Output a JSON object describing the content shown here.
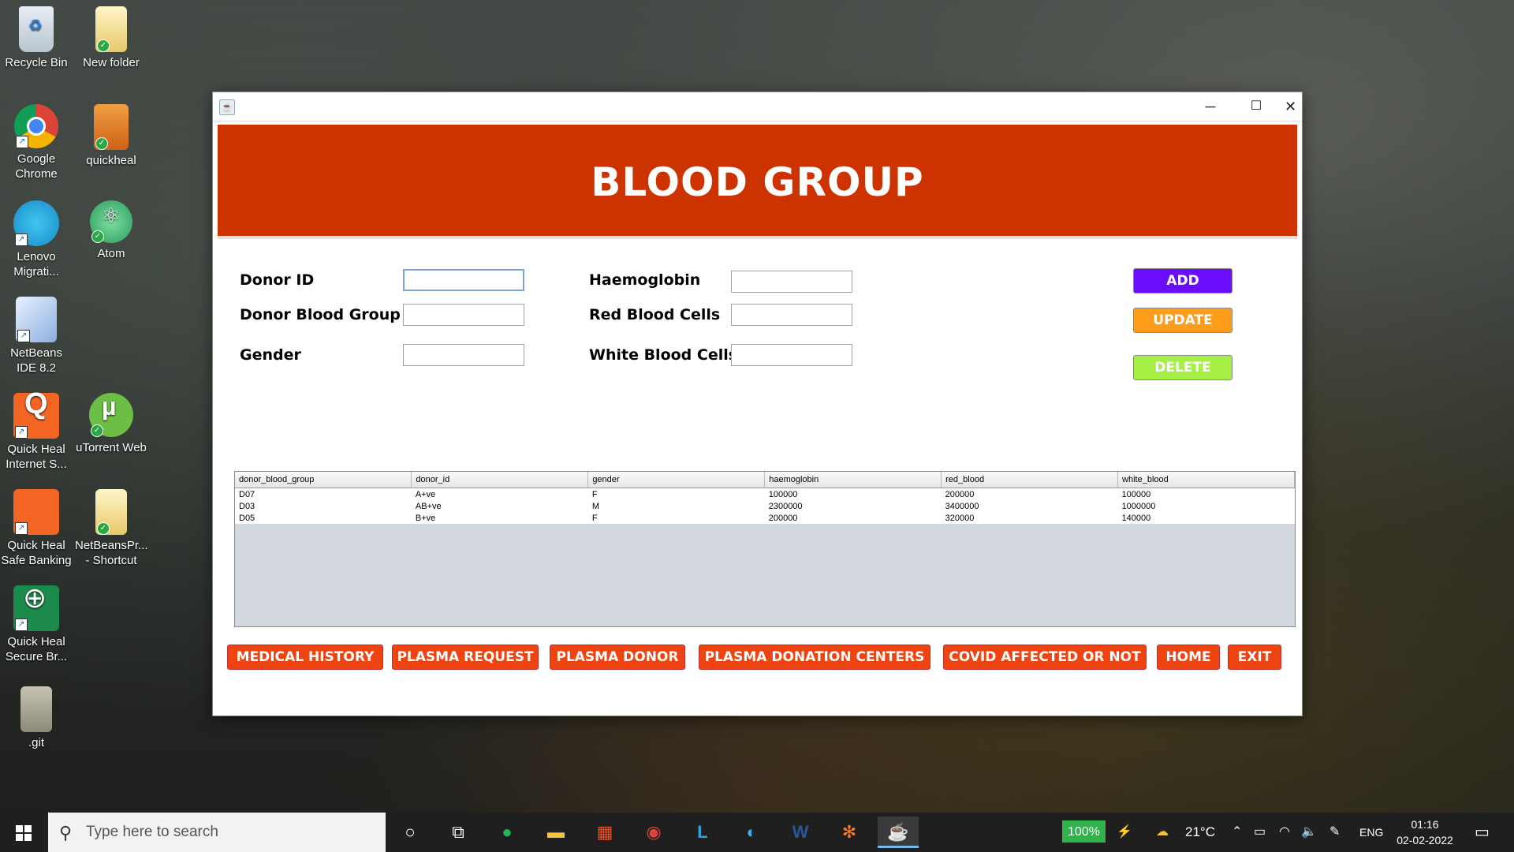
{
  "desktop": {
    "icons": [
      {
        "label": "Recycle Bin",
        "icon": "recycle-bin-icon"
      },
      {
        "label": "New folder",
        "icon": "folder-icon"
      },
      {
        "label": "Google Chrome",
        "icon": "chrome-icon"
      },
      {
        "label": "quickheal",
        "icon": "quickheal-folder-icon"
      },
      {
        "label": "Lenovo Migrati...",
        "icon": "lenovo-migration-icon"
      },
      {
        "label": "Atom",
        "icon": "atom-icon"
      },
      {
        "label": "NetBeans IDE 8.2",
        "icon": "netbeans-icon"
      },
      {
        "label": "Quick Heal Internet S...",
        "icon": "quickheal-icon"
      },
      {
        "label": "uTorrent Web",
        "icon": "utorrent-icon"
      },
      {
        "label": "Quick Heal Safe Banking",
        "icon": "safe-banking-icon"
      },
      {
        "label": "NetBeansPr... - Shortcut",
        "icon": "folder-shortcut-icon"
      },
      {
        "label": "Quick Heal Secure Br...",
        "icon": "secure-browser-icon"
      },
      {
        "label": ".git",
        "icon": "git-folder-icon"
      }
    ]
  },
  "window": {
    "header_title": "BLOOD GROUP",
    "controls": {
      "minimize": "─",
      "maximize": "☐",
      "close": "✕"
    }
  },
  "form": {
    "donor_id_label": "Donor ID",
    "donor_blood_group_label": "Donor Blood Group",
    "gender_label": "Gender",
    "haemoglobin_label": "Haemoglobin",
    "red_blood_cells_label": "Red Blood Cells",
    "white_blood_cells_label": "White Blood Cells",
    "donor_id_value": "",
    "donor_blood_group_value": "",
    "gender_value": "",
    "haemoglobin_value": "",
    "red_blood_cells_value": "",
    "white_blood_cells_value": ""
  },
  "actions": {
    "add": "ADD",
    "update": "UPDATE",
    "delete": "DELETE",
    "add_color": "#6a0dfa",
    "update_color": "#ff9c1a",
    "delete_color": "#a6f046"
  },
  "table": {
    "columns": [
      "donor_blood_group",
      "donor_id",
      "gender",
      "haemoglobin",
      "red_blood",
      "white_blood"
    ],
    "rows": [
      [
        "D07",
        "A+ve",
        "F",
        "100000",
        "200000",
        "100000"
      ],
      [
        "D03",
        "AB+ve",
        "M",
        "2300000",
        "3400000",
        "1000000"
      ],
      [
        "D05",
        "B+ve",
        "F",
        "200000",
        "320000",
        "140000"
      ]
    ]
  },
  "nav": {
    "medical_history": "MEDICAL HISTORY",
    "plasma_request": "PLASMA REQUEST",
    "plasma_donor": "PLASMA DONOR",
    "plasma_donation_centers": "PLASMA DONATION CENTERS",
    "covid_affected": "COVID AFFECTED OR NOT",
    "home": "HOME",
    "exit": "EXIT"
  },
  "taskbar": {
    "search_placeholder": "Type here to search",
    "battery": "100%",
    "temperature": "21°C",
    "language": "ENG",
    "time": "01:16",
    "date": "02-02-2022"
  }
}
